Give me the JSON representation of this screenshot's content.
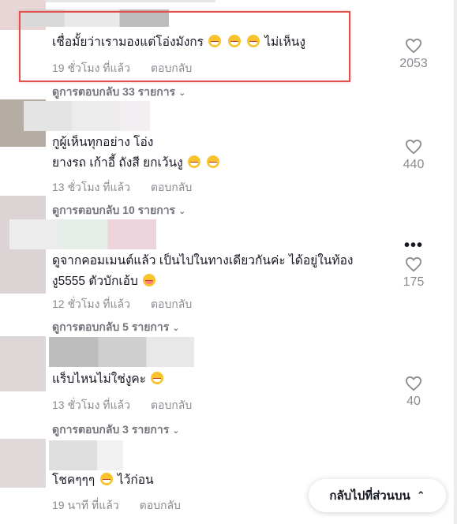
{
  "comments": [
    {
      "lines": [
        "เชื่อมั้ยว่าเรามองแต่โอ่งมังกร",
        "ไม่เห็นงู"
      ],
      "time": "19 ชั่วโมง ที่แล้ว",
      "reply_label": "ตอบกลับ",
      "likes": "2053",
      "view_replies": "ดูการตอบกลับ 33 รายการ"
    },
    {
      "lines": [
        "กูผู้เห็นทุกอย่าง โอ่ง",
        "ยางรถ เก้าอี้ ถังสี ยกเว้นงู"
      ],
      "time": "13 ชั่วโมง ที่แล้ว",
      "reply_label": "ตอบกลับ",
      "likes": "440",
      "view_replies": "ดูการตอบกลับ 10 รายการ"
    },
    {
      "lines": [
        "ดูจากคอมเมนต์แล้ว เป็นไปในทางเดียวกันค่ะ ได้อยู่ในท้อง",
        "งู5555 ตัวบักเอ้บ"
      ],
      "time": "12 ชั่วโมง ที่แล้ว",
      "reply_label": "ตอบกลับ",
      "likes": "175",
      "view_replies": "ดูการตอบกลับ 5 รายการ"
    },
    {
      "lines": [
        "แร็บไหนไม่ใช่งูคะ"
      ],
      "time": "13 ชั่วโมง ที่แล้ว",
      "reply_label": "ตอบกลับ",
      "likes": "40",
      "view_replies": "ดูการตอบกลับ 3 รายการ"
    },
    {
      "lines": [
        "โชคๆๆๆ",
        "ไว้ก่อน"
      ],
      "time": "19 นาที ที่แล้ว",
      "reply_label": "ตอบกลับ"
    }
  ],
  "more_options_icon": "ellipsis-icon",
  "back_to_top": {
    "label": "กลับไปที่ส่วนบน",
    "icon": "chevron-up-icon"
  },
  "colors": {
    "highlight": "#e0504d",
    "text": "#161823",
    "muted": "#8a8b91"
  }
}
